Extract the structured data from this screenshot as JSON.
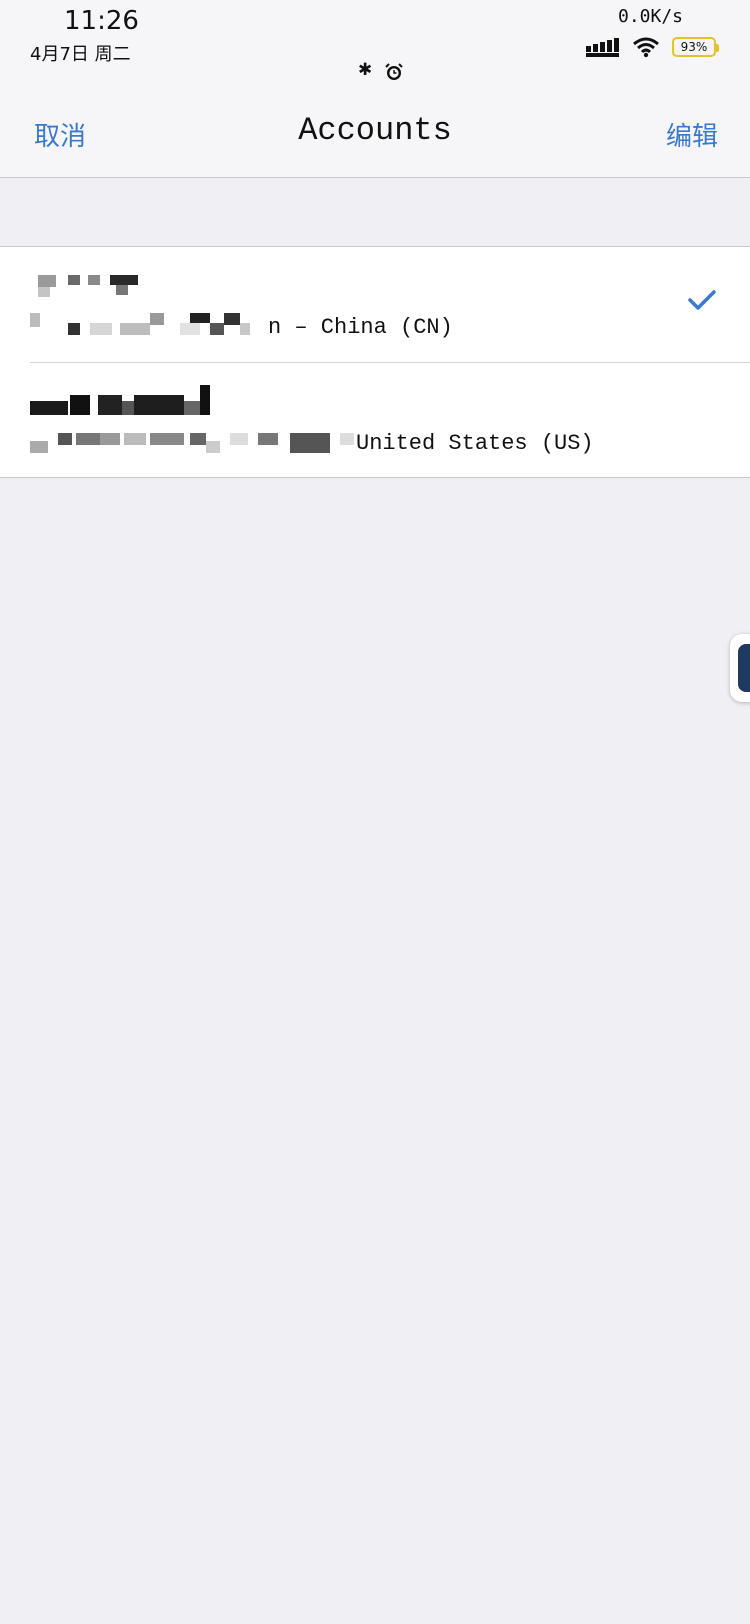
{
  "status_bar": {
    "time": "11:26",
    "date": "4月7日  周二",
    "net_speed": "0.0K/s",
    "battery": "93%",
    "icons": [
      "signal-icon",
      "wifi-icon",
      "battery-icon",
      "bluetooth-icon",
      "alarm-icon"
    ]
  },
  "nav": {
    "cancel_label": "取消",
    "title": "Accounts",
    "edit_label": "编辑"
  },
  "accounts": [
    {
      "name": "",
      "subtitle": "n – China (CN)",
      "selected": true
    },
    {
      "name": "",
      "subtitle": "United States (US)",
      "selected": false
    }
  ],
  "colors": {
    "accent": "#3a79d0",
    "background": "#efeff4",
    "battery": "#e6c22a"
  }
}
